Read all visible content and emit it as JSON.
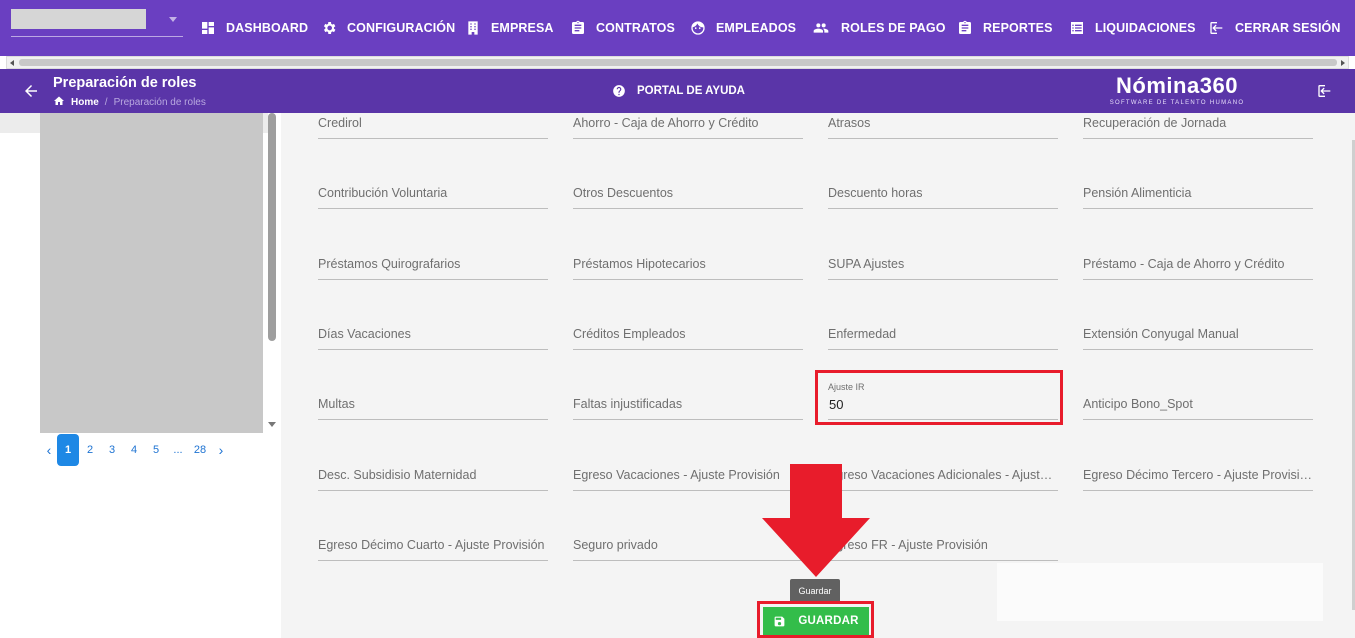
{
  "nav": {
    "items": [
      {
        "label": "DASHBOARD",
        "icon": "dashboard-icon"
      },
      {
        "label": "CONFIGURACIÓN",
        "icon": "gear-icon"
      },
      {
        "label": "EMPRESA",
        "icon": "building-icon"
      },
      {
        "label": "CONTRATOS",
        "icon": "clipboard-icon"
      },
      {
        "label": "EMPLEADOS",
        "icon": "face-icon"
      },
      {
        "label": "ROLES DE PAGO",
        "icon": "people-icon"
      },
      {
        "label": "REPORTES",
        "icon": "clipboard-icon"
      },
      {
        "label": "LIQUIDACIONES",
        "icon": "list-icon"
      },
      {
        "label": "CERRAR SESIÓN",
        "icon": "logout-icon"
      }
    ]
  },
  "header": {
    "title": "Preparación de roles",
    "breadcrumb_home": "Home",
    "breadcrumb_separator": "/",
    "breadcrumb_current": "Preparación de roles",
    "help_label": "PORTAL DE AYUDA",
    "brand_name": "Nómina360",
    "brand_tagline": "SOFTWARE DE TALENTO HUMANO"
  },
  "pagination": {
    "pages": [
      "1",
      "2",
      "3",
      "4",
      "5",
      "...",
      "28"
    ],
    "active": "1",
    "prev": "‹",
    "next": "›"
  },
  "form": {
    "fields": [
      "Credirol",
      "Ahorro - Caja de Ahorro y Crédito",
      "Atrasos",
      "Recuperación de Jornada",
      "Contribución Voluntaria",
      "Otros Descuentos",
      "Descuento horas",
      "Pensión Alimenticia",
      "Préstamos Quirografarios",
      "Préstamos Hipotecarios",
      "SUPA Ajustes",
      "Préstamo - Caja de Ahorro y Crédito",
      "Días Vacaciones",
      "Créditos Empleados",
      "Enfermedad",
      "Extensión Conyugal Manual",
      "Multas",
      "Faltas injustificadas",
      "Ajuste IR",
      "Anticipo Bono_Spot",
      "Desc. Subsidisio Maternidad",
      "Egreso Vacaciones - Ajuste Provisión",
      "Egreso Vacaciones Adicionales - Ajuste Provisión",
      "Egreso Décimo Tercero - Ajuste Provisión",
      "Egreso Décimo Cuarto - Ajuste Provisión",
      "Seguro privado",
      "Egreso FR - Ajuste Provisión"
    ],
    "ajuste_ir_value": "50"
  },
  "actions": {
    "tooltip": "Guardar",
    "save_label": "GUARDAR"
  },
  "colors": {
    "nav_bg": "#6a3fc1",
    "subheader_bg": "#5a35a8",
    "save_button": "#33bd4a",
    "highlight": "#e81c2b",
    "active_page": "#1e88e5"
  }
}
